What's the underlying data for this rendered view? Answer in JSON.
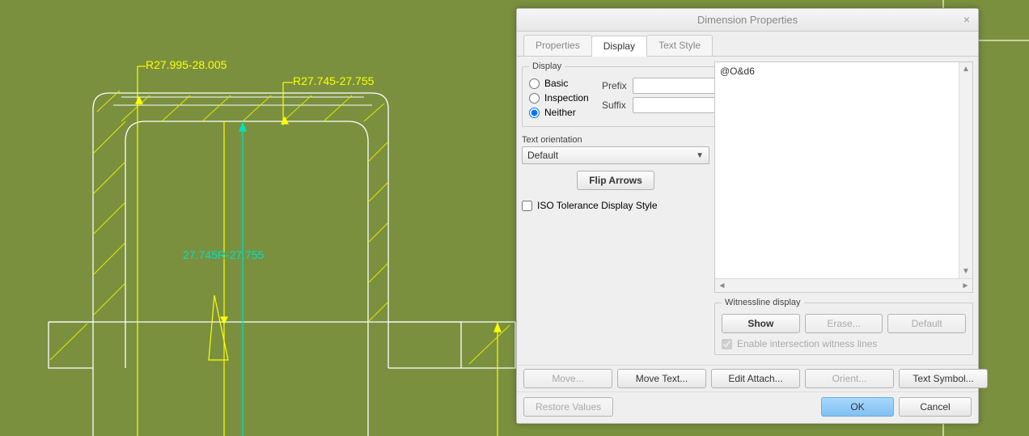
{
  "canvas": {
    "dims": {
      "yellow1": "R27.995-28.005",
      "yellow2": "R27.745-27.755",
      "ref": "27.745R-27.755"
    },
    "colors": {
      "bg": "#7a903f",
      "outline": "#ffffff",
      "hatch": "#e6e600",
      "dim_yellow": "#ffff00",
      "dim_ref": "#00e0c0"
    }
  },
  "dialog": {
    "title": "Dimension Properties",
    "tabs": [
      "Properties",
      "Display",
      "Text Style"
    ],
    "active_tab": 1,
    "display": {
      "legend": "Display",
      "radios": {
        "basic": "Basic",
        "inspection": "Inspection",
        "neither": "Neither"
      },
      "radio_selected": "neither",
      "prefix_label": "Prefix",
      "suffix_label": "Suffix",
      "prefix_value": "",
      "suffix_value": ""
    },
    "text_orientation_label": "Text orientation",
    "text_orientation_value": "Default",
    "flip_arrows": "Flip Arrows",
    "iso_tol_label": "ISO Tolerance Display Style",
    "iso_tol_checked": false,
    "preview_text": "@O&d6",
    "witness": {
      "legend": "Witnessline display",
      "show": "Show",
      "erase": "Erase...",
      "default": "Default",
      "intersection_label": "Enable intersection witness lines",
      "intersection_checked": true
    },
    "bottom_buttons": {
      "move": "Move...",
      "move_text": "Move Text...",
      "edit_attach": "Edit Attach...",
      "orient": "Orient...",
      "text_symbol": "Text Symbol..."
    },
    "footer": {
      "restore": "Restore Values",
      "ok": "OK",
      "cancel": "Cancel"
    }
  }
}
